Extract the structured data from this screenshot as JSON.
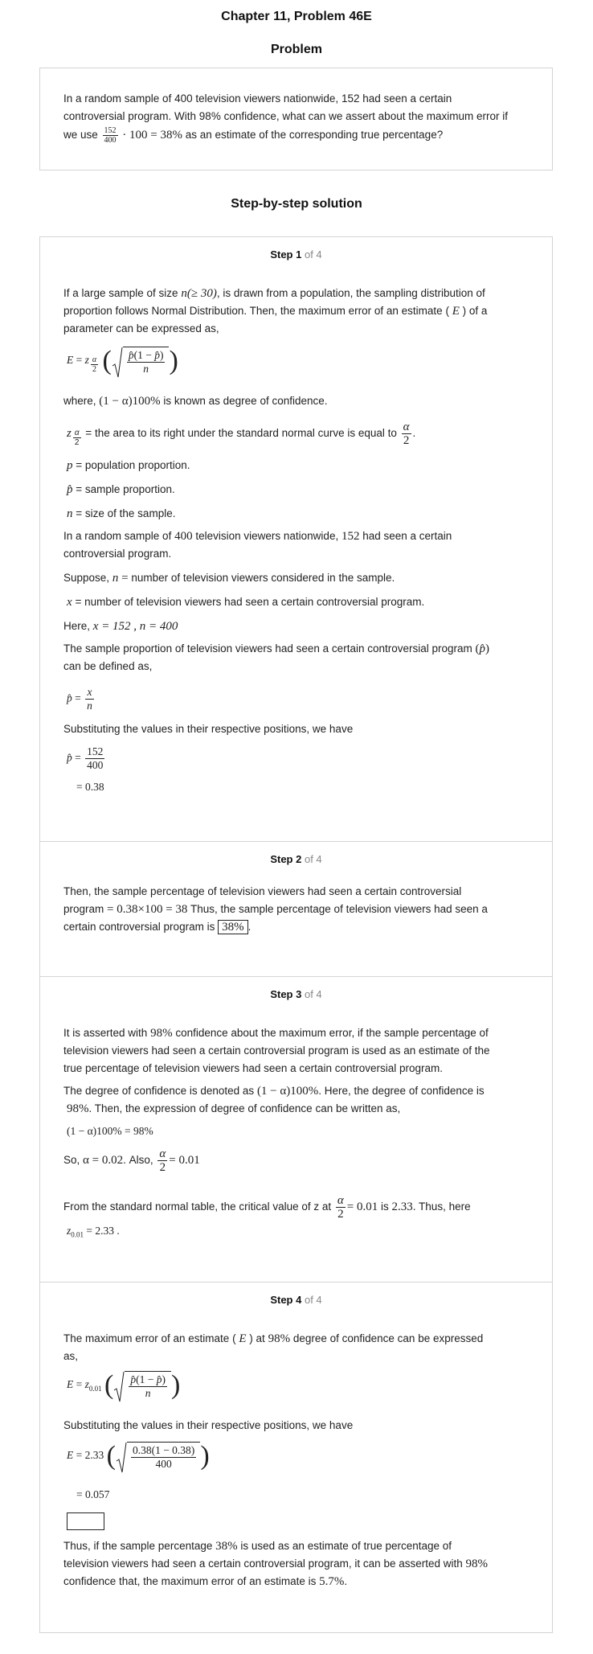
{
  "header": {
    "chapter": "Chapter 11, Problem 46E",
    "problem_heading": "Problem",
    "solution_heading": "Step-by-step solution"
  },
  "problem": {
    "text_1": "In a random sample of 400 television viewers nationwide, 152 had seen a certain",
    "text_2": "controversial program. With 98% confidence, what can we assert about the maximum error if",
    "text_3a": "we use",
    "expr_num": "152",
    "expr_den": "400",
    "expr_rest": "· 100 = 38%",
    "text_3b": "as an estimate of the corresponding true percentage?"
  },
  "steps": [
    {
      "label": "Step 1",
      "of": "of 4",
      "p1_a": "If a large sample of size",
      "p1_math": "n(≥ 30)",
      "p1_b": ", is drawn from a population, the sampling distribution of",
      "p1_c": "proportion follows Normal Distribution. Then, the maximum error of an estimate (",
      "p1_math2": "E",
      "p1_d": ") of a",
      "p1_e": "parameter can be expressed as,",
      "where_a": "where,",
      "where_math": "(1 − α)100%",
      "where_b": "is known as degree of confidence.",
      "z_desc": "the area to its right under the standard normal curve is equal to",
      "p_desc": "= population proportion.",
      "phat_desc": "= sample proportion.",
      "n_desc": "= size of the sample.",
      "rs_a": "In a random sample of",
      "rs_400": "400",
      "rs_b": "television viewers nationwide,",
      "rs_152": "152",
      "rs_c": "had seen a certain",
      "rs_d": "controversial program.",
      "suppose_a": "Suppose,",
      "suppose_b": "number of television viewers considered in the sample.",
      "x_desc": "= number of television viewers had seen a certain controversial program.",
      "here_label": "Here,",
      "here_vals": "x = 152 ,  n = 400",
      "sp_a": "The sample proportion of television viewers had seen a certain controversial program",
      "sp_b": "can be defined as,",
      "subst": "Substituting the values in their respective positions, we have",
      "calc_num": "152",
      "calc_den": "400",
      "calc_res": "= 0.38"
    },
    {
      "label": "Step 2",
      "of": "of 4",
      "t1": "Then, the sample percentage of television viewers had seen a certain controversial",
      "t2a": "program",
      "t2_math": "= 0.38×100  = 38",
      "t2b": "Thus, the sample percentage of television viewers had seen a",
      "t3a": "certain controversial program is",
      "t3_box": "38%"
    },
    {
      "label": "Step 3",
      "of": "of 4",
      "a1": "It is asserted with",
      "a1_math": "98%",
      "a1b": "confidence about the maximum error, if the sample percentage of",
      "a2": "television viewers had seen a certain controversial program is used as an estimate of the",
      "a3": "true percentage of television viewers had seen a certain controversial program.",
      "d1a": "The degree of confidence is denoted as",
      "d1_math": "(1 − α)100%",
      "d1b": ". Here, the degree of confidence is",
      "d2_math": "98%",
      "d2b": ". Then, the expression of degree of confidence can be written as,",
      "eq": "(1 − α)100% = 98%",
      "so_a": "So,",
      "so_math": "α = 0.02",
      "so_b": ". Also,",
      "so_res": "= 0.01",
      "ft_a": "From the standard normal table, the critical value of z at",
      "ft_res": "= 0.01",
      "ft_b": "is",
      "ft_val": "2.33",
      "ft_c": ". Thus, here",
      "z_line": "= 2.33 ."
    },
    {
      "label": "Step 4",
      "of": "of 4",
      "m1a": "The maximum error of an estimate (",
      "m1_math": "E",
      "m1b": ") at",
      "m1_98": "98%",
      "m1c": "degree of confidence can be expressed",
      "m2": "as,",
      "subst": "Substituting the values in their respective positions, we have",
      "calc_num": "0.38(1 − 0.38)",
      "calc_den": "400",
      "calc_res": "= 0.057",
      "f1a": "Thus, if the sample percentage",
      "f1_math": "38%",
      "f1b": "is used as an estimate of true percentage of",
      "f2a": "television viewers had seen a certain controversial program, it can be asserted with",
      "f2_math": "98%",
      "f3a": "confidence that, the maximum error of an estimate is",
      "f3_math": "5.7%",
      "f3b": "."
    }
  ]
}
